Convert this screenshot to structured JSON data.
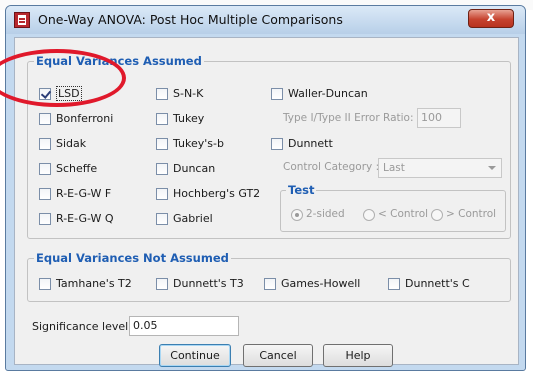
{
  "window": {
    "title": "One-Way ANOVA: Post Hoc Multiple Comparisons",
    "close_glyph": "x"
  },
  "equal_variances_assumed": {
    "label": "Equal Variances Assumed",
    "checkboxes": [
      {
        "label": "LSD",
        "checked": true
      },
      {
        "label": "Bonferroni",
        "checked": false
      },
      {
        "label": "Sidak",
        "checked": false
      },
      {
        "label": "Scheffe",
        "checked": false
      },
      {
        "label": "R-E-G-W F",
        "checked": false
      },
      {
        "label": "R-E-G-W Q",
        "checked": false
      },
      {
        "label": "S-N-K",
        "checked": false
      },
      {
        "label": "Tukey",
        "checked": false
      },
      {
        "label": "Tukey's-b",
        "checked": false
      },
      {
        "label": "Duncan",
        "checked": false
      },
      {
        "label": "Hochberg's GT2",
        "checked": false
      },
      {
        "label": "Gabriel",
        "checked": false
      },
      {
        "label": "Waller-Duncan",
        "checked": false
      },
      {
        "label": "Dunnett",
        "checked": false
      }
    ],
    "error_ratio_label": "Type I/Type II Error Ratio:",
    "error_ratio_value": "100",
    "control_category_label": "Control Category :",
    "control_category_value": "Last",
    "test": {
      "label": "Test",
      "options": [
        {
          "label": "2-sided",
          "selected": true
        },
        {
          "label": "< Control",
          "selected": false
        },
        {
          "label": "> Control",
          "selected": false
        }
      ]
    }
  },
  "equal_variances_not_assumed": {
    "label": "Equal Variances Not Assumed",
    "checkboxes": [
      {
        "label": "Tamhane's T2",
        "checked": false
      },
      {
        "label": "Dunnett's T3",
        "checked": false
      },
      {
        "label": "Games-Howell",
        "checked": false
      },
      {
        "label": "Dunnett's C",
        "checked": false
      }
    ]
  },
  "significance": {
    "label": "Significance level:",
    "value": "0.05"
  },
  "buttons": {
    "continue": "Continue",
    "cancel": "Cancel",
    "help": "Help"
  },
  "colors": {
    "group_label": "#1f5eb3",
    "annotation_circle": "#e0192b",
    "close_button": "#c6432f"
  }
}
